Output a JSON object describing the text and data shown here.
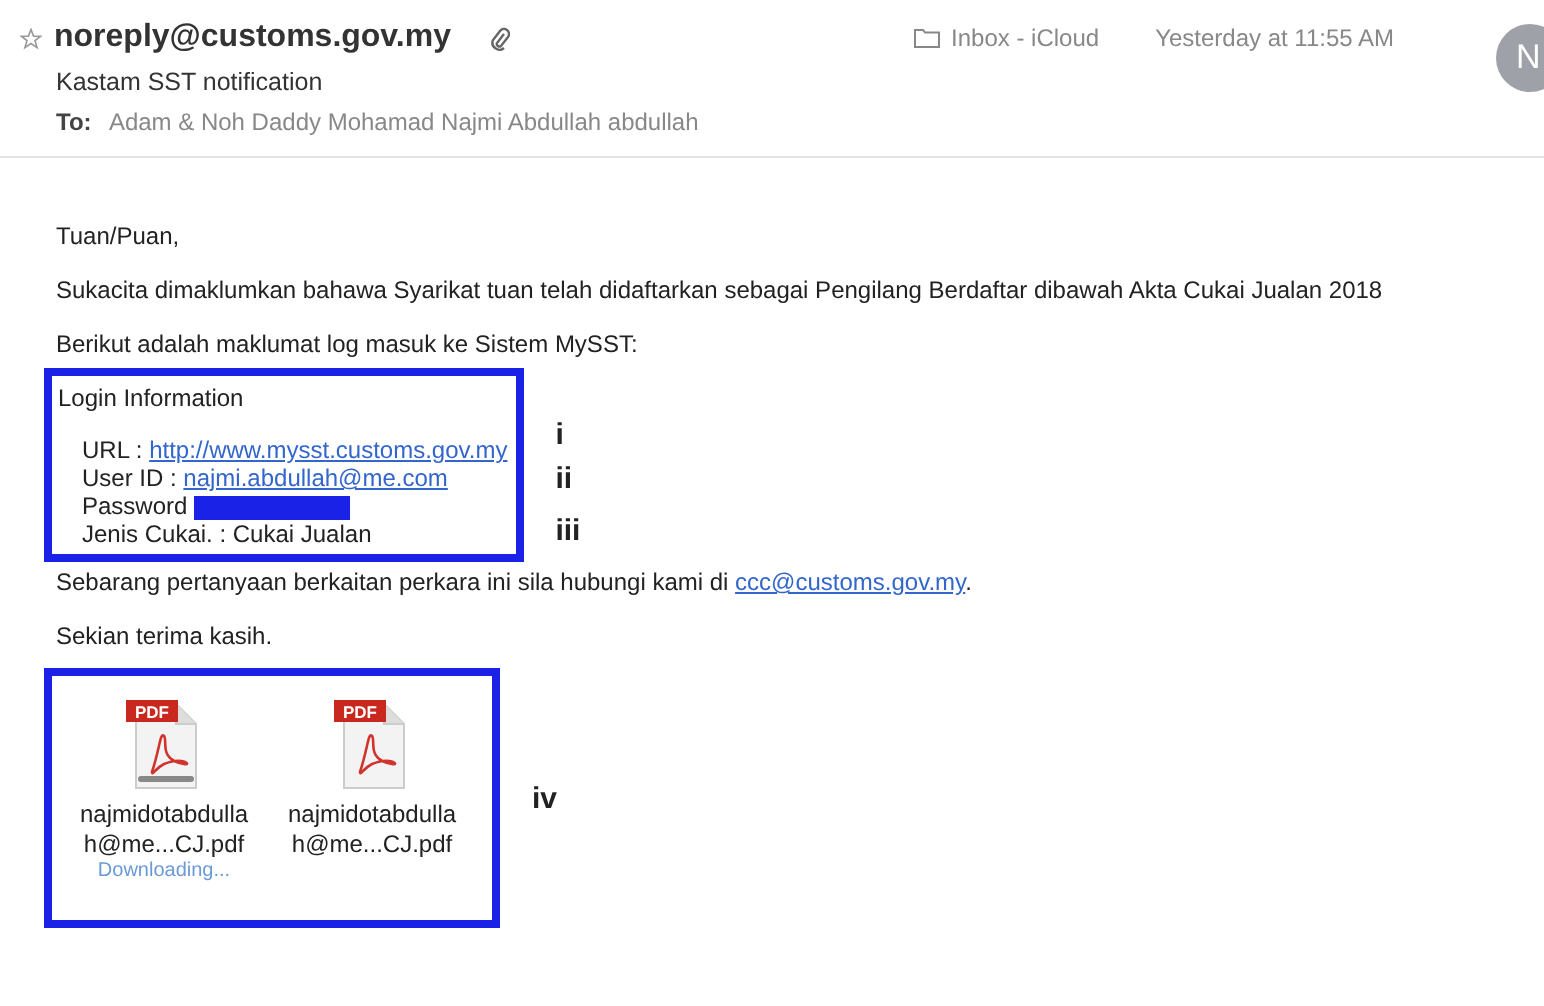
{
  "header": {
    "starred": false,
    "sender": "noreply@customs.gov.my",
    "has_attachment": true,
    "subject": "Kastam SST notification",
    "to_label": "To:",
    "to": "Adam & Noh Daddy Mohamad Najmi Abdullah abdullah",
    "mailbox": "Inbox - iCloud",
    "time": "Yesterday at 11:55 AM",
    "avatar": "N"
  },
  "body": {
    "greeting": "Tuan/Puan,",
    "intro": "Sukacita dimaklumkan bahawa Syarikat tuan telah didaftarkan sebagai Pengilang Berdaftar dibawah Akta Cukai Jualan 2018",
    "lead": "Berikut adalah maklumat log masuk ke Sistem MySST:",
    "login": {
      "title": "Login Information",
      "lines": [
        {
          "kind": "link",
          "label": "URL : ",
          "value": "http://www.mysst.customs.gov.my"
        },
        {
          "kind": "link",
          "label": "User ID : ",
          "value": "najmi.abdullah@me.com"
        },
        {
          "kind": "redacted",
          "label": "Password "
        },
        {
          "kind": "text",
          "label": "Jenis Cukai. : Cukai Jualan"
        }
      ],
      "markers": [
        "i",
        "ii",
        "iii"
      ]
    },
    "contact": {
      "text": "Sebarang pertanyaan berkaitan perkara ini sila hubungi kami di ",
      "link": "ccc@customs.gov.my",
      "after": "."
    },
    "closing": "Sekian terima kasih.",
    "attachments": [
      {
        "badge": "PDF",
        "name_1": "najmidotabdulla",
        "name_2": "h@me...CJ.pdf",
        "status": "Downloading..."
      },
      {
        "badge": "PDF",
        "name_1": "najmidotabdulla",
        "name_2": "h@me...CJ.pdf"
      }
    ],
    "attachments_marker": "iv"
  }
}
